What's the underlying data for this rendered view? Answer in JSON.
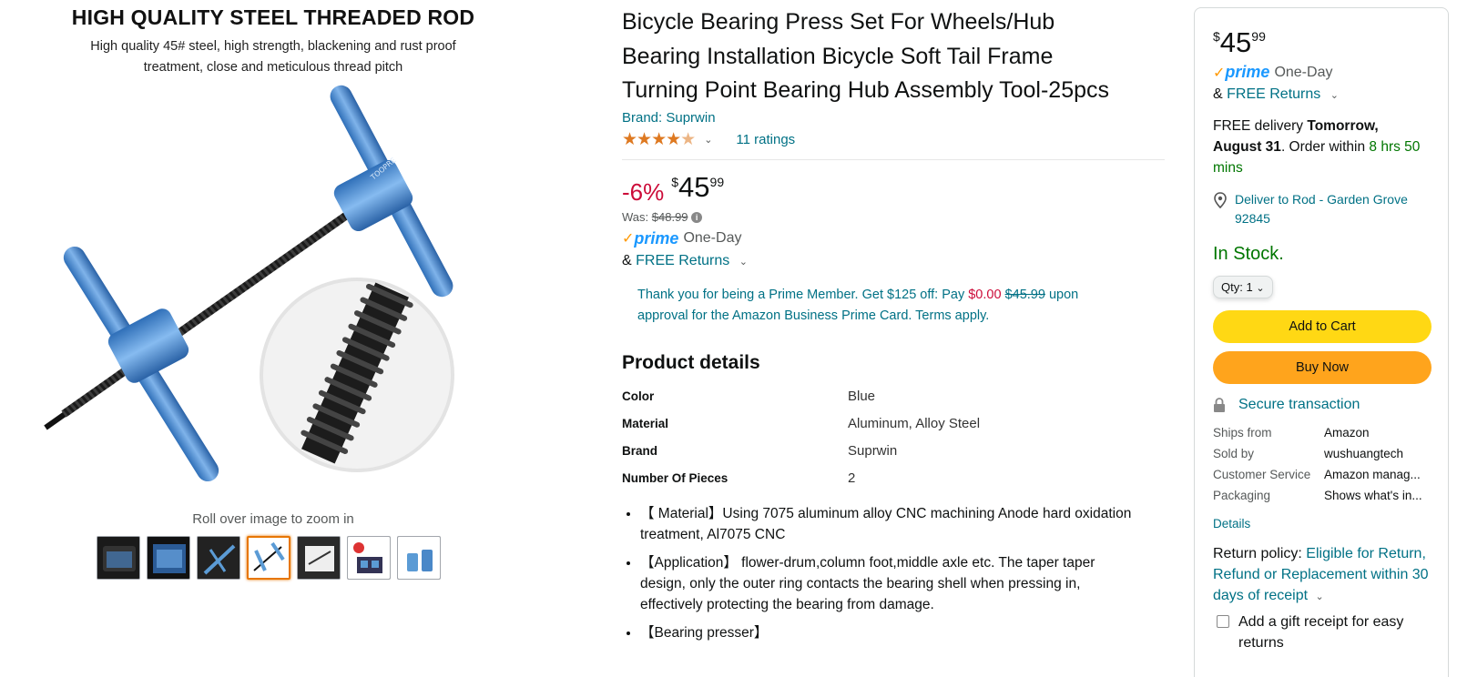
{
  "gallery": {
    "hero_title": "HIGH QUALITY STEEL THREADED ROD",
    "hero_subtitle": "High quality 45# steel, high strength, blackening and rust proof treatment, close and meticulous thread pitch",
    "hero_engraving": "TOOPRE",
    "zoom_hint": "Roll over image to zoom in",
    "thumb_count": 7,
    "active_thumb": 4
  },
  "product": {
    "title": "Bicycle Bearing Press Set For Wheels/Hub Bearing Installation Bicycle Soft Tail Frame Turning Point Bearing Hub Assembly Tool-25pcs",
    "brand": "Brand: Suprwin",
    "rating": 4.5,
    "ratings_count": "11 ratings",
    "discount": "-6%",
    "price_symbol": "$",
    "price_whole": "45",
    "price_fraction": "99",
    "was_label": "Was:",
    "was_price": "$48.99",
    "prime_word": "prime",
    "prime_delivery": "One-Day",
    "returns_prefix": "&",
    "returns_link": "FREE Returns",
    "offer_text_1": "Thank you for being a Prime Member. Get $125 off: Pay",
    "offer_pay": "$0.00",
    "offer_strike": "$45.99",
    "offer_text_2": "upon approval for the Amazon Business Prime Card. Terms apply."
  },
  "details": {
    "heading": "Product details",
    "rows": [
      {
        "key": "Color",
        "value": "Blue"
      },
      {
        "key": "Material",
        "value": "Aluminum, Alloy Steel"
      },
      {
        "key": "Brand",
        "value": "Suprwin"
      },
      {
        "key": "Number Of Pieces",
        "value": "2"
      }
    ],
    "bullets": [
      "【 Material】Using 7075 aluminum alloy CNC machining Anode hard oxidation treatment, Al7075 CNC",
      "【Application】 flower-drum,column foot,middle axle etc. The taper taper design, only the outer ring contacts the bearing shell when pressing in, effectively protecting the bearing from damage.",
      "【Bearing presser】"
    ]
  },
  "buybox": {
    "price_symbol": "$",
    "price_whole": "45",
    "price_fraction": "99",
    "prime_word": "prime",
    "prime_delivery": "One-Day",
    "returns_prefix": "&",
    "returns_link": "FREE Returns",
    "delivery_prefix": "FREE delivery",
    "delivery_date": "Tomorrow, August 31",
    "order_within": ". Order within",
    "countdown": "8 hrs 50 mins",
    "deliver_to": "Deliver to Rod - Garden Grove 92845",
    "stock": "In Stock.",
    "qty_label": "Qty:",
    "qty_value": "1",
    "add_to_cart": "Add to Cart",
    "buy_now": "Buy Now",
    "secure": "Secure transaction",
    "ships_rows": [
      {
        "key": "Ships from",
        "value": "Amazon"
      },
      {
        "key": "Sold by",
        "value": "wushuangtech"
      },
      {
        "key": "Customer Service",
        "value": "Amazon manag..."
      },
      {
        "key": "Packaging",
        "value": "Shows what's in..."
      }
    ],
    "details_link": "Details",
    "return_policy_label": "Return policy:",
    "return_policy_link": "Eligible for Return, Refund or Replacement within 30 days of receipt",
    "gift_receipt": "Add a gift receipt for easy returns"
  },
  "colors": {
    "link": "#007185",
    "deal_red": "#cc0c39",
    "stock_green": "#007600",
    "cart_yellow": "#ffd814",
    "buy_orange": "#ffa41c",
    "star_orange": "#de7921",
    "tool_blue": "#5b9bd5"
  }
}
